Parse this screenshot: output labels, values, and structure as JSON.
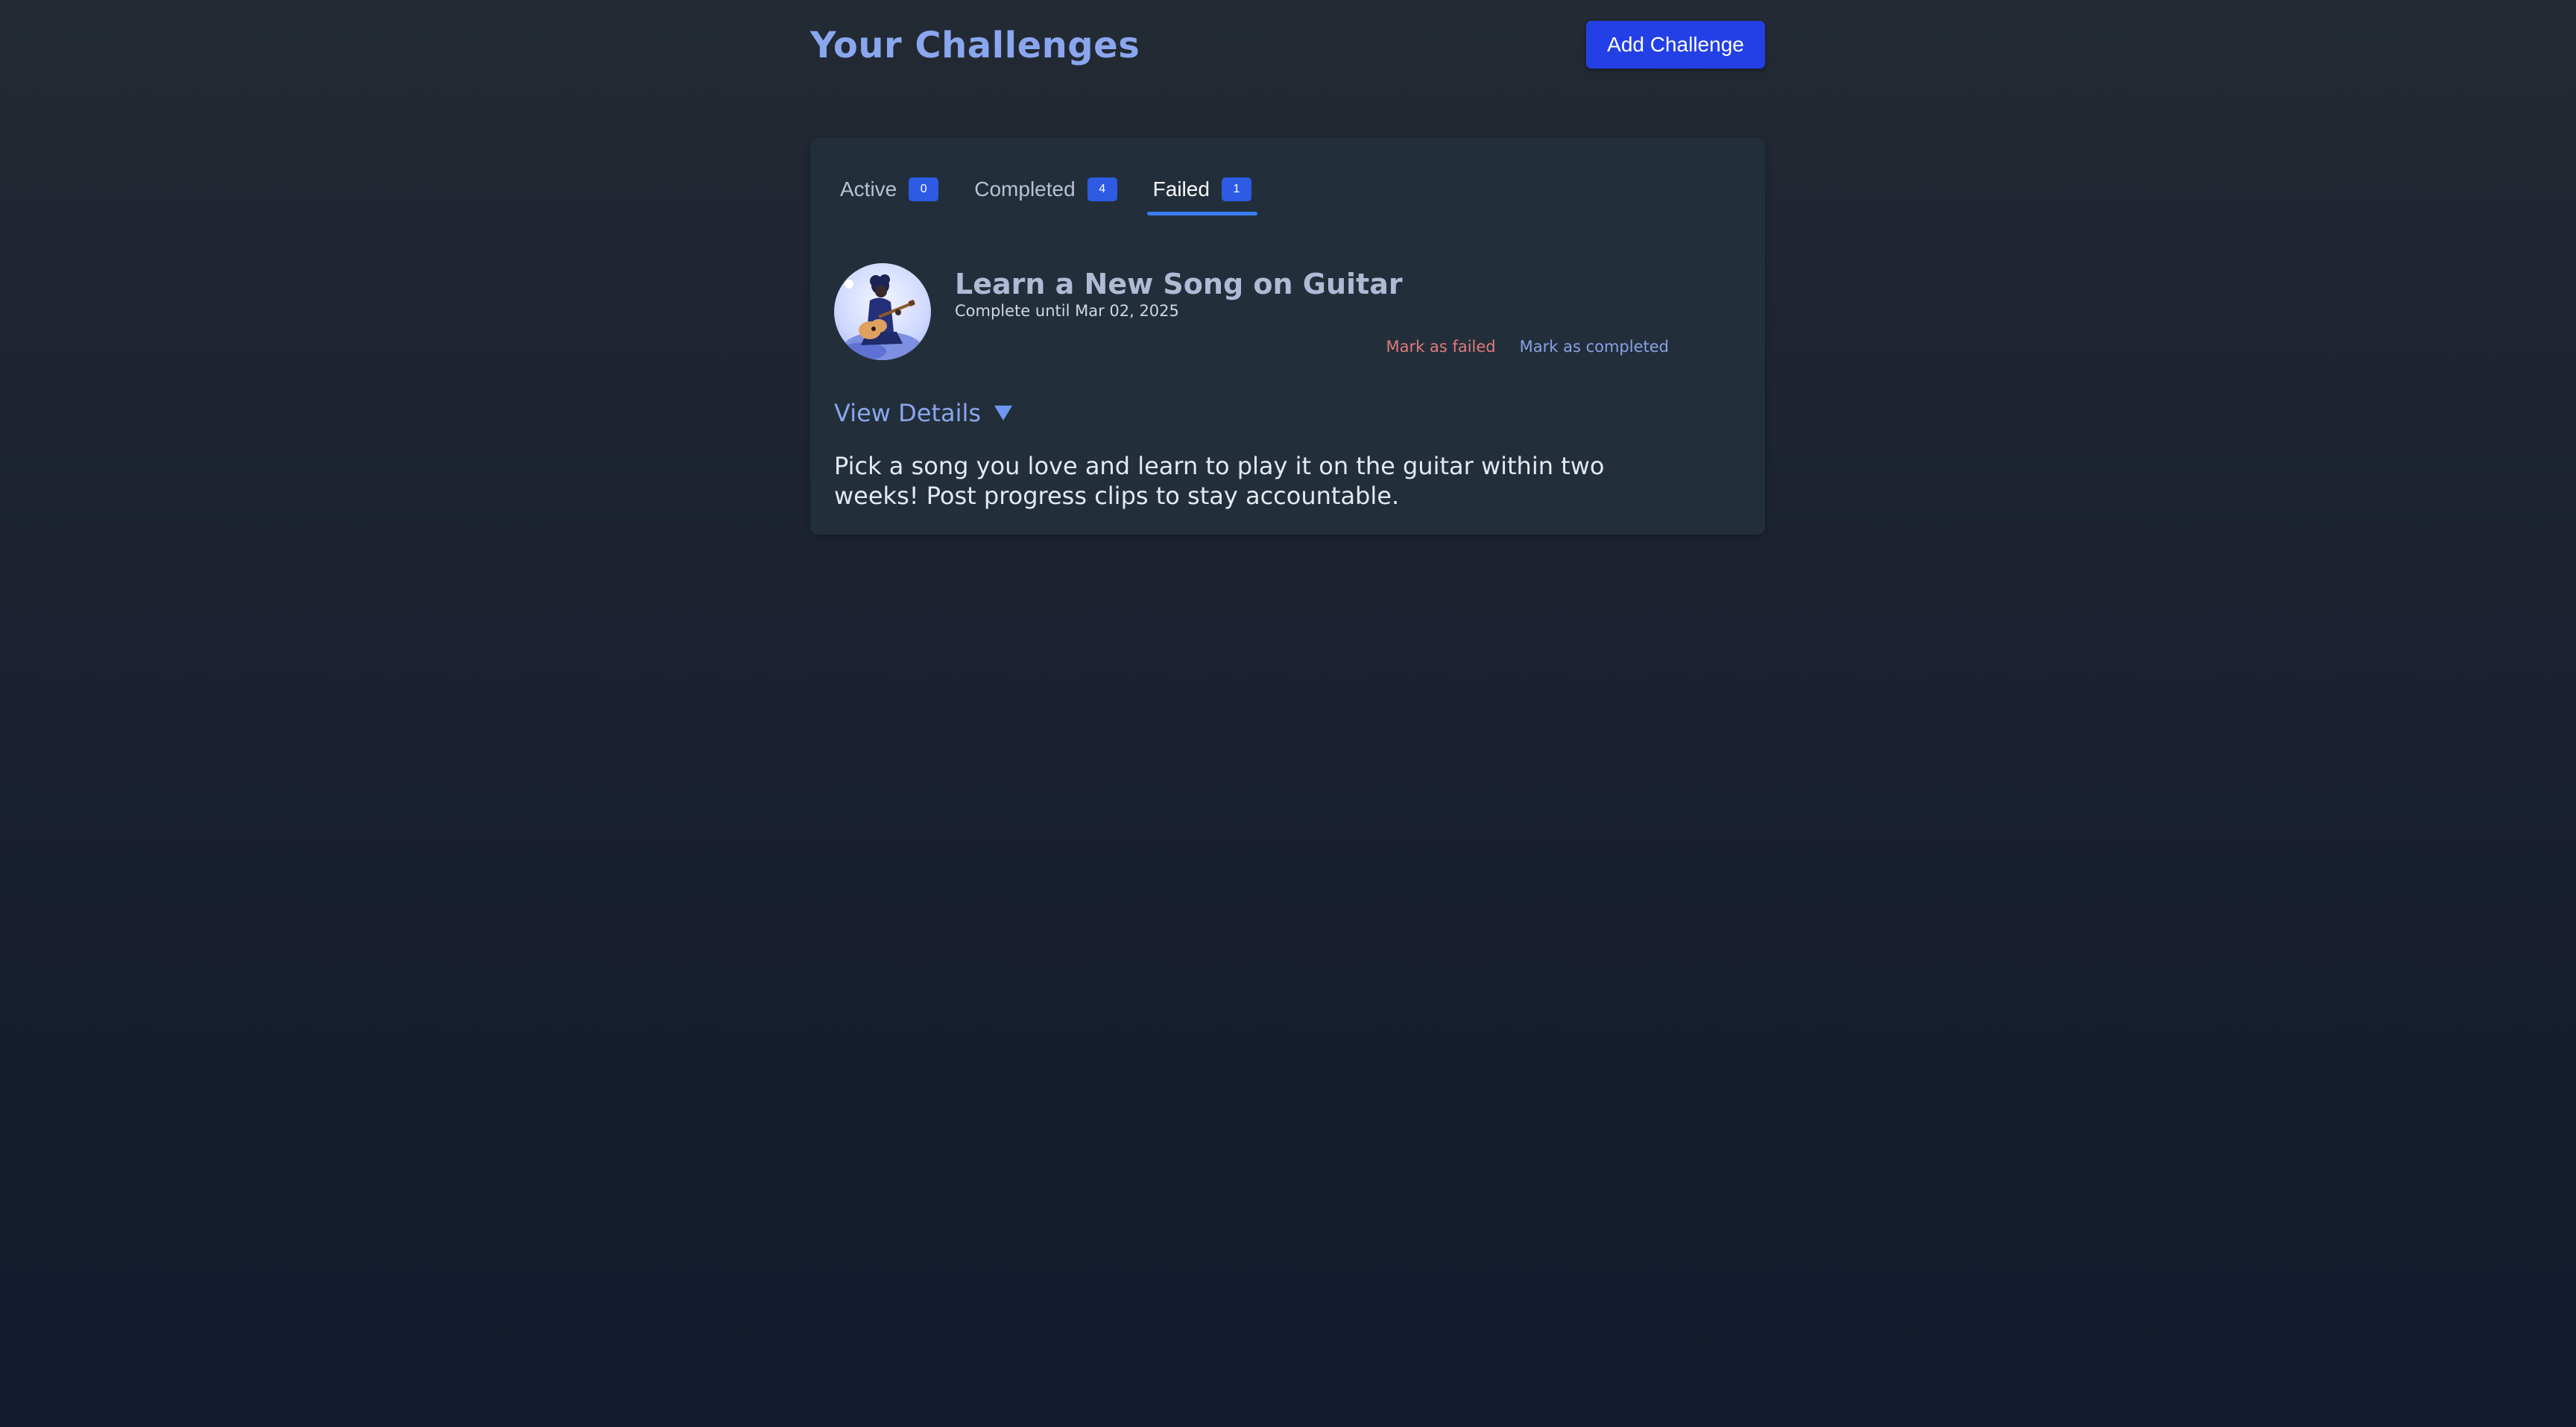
{
  "header": {
    "title": "Your Challenges",
    "add_button_label": "Add Challenge"
  },
  "tabs": [
    {
      "label": "Active",
      "count": "0",
      "active": false
    },
    {
      "label": "Completed",
      "count": "4",
      "active": false
    },
    {
      "label": "Failed",
      "count": "1",
      "active": true
    }
  ],
  "challenge": {
    "title": "Learn a New Song on Guitar",
    "due_text": "Complete until Mar 02, 2025",
    "avatar_icon": "guitarist-illustration-icon",
    "actions": {
      "mark_failed_label": "Mark as failed",
      "mark_completed_label": "Mark as completed"
    },
    "details_toggle_label": "View Details",
    "description": "Pick a song you love and learn to play it on the guitar within two weeks! Post progress clips to stay accountable."
  },
  "colors": {
    "accent": "#2340e6",
    "title": "#8aa6ee",
    "tab_indicator": "#3b7cf0",
    "failed_link": "#e07a7a",
    "completed_link": "#8aa0e6"
  }
}
